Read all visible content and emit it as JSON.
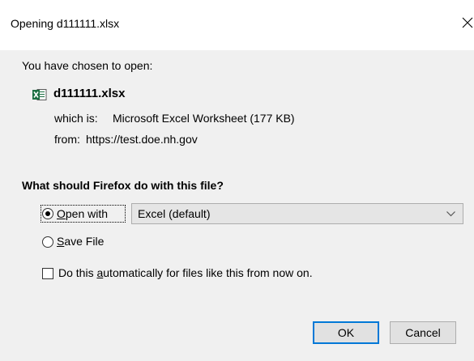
{
  "window": {
    "title": "Opening d111111.xlsx"
  },
  "intro": {
    "chosen_text": "You have chosen to open:"
  },
  "file": {
    "icon": "excel-file-icon",
    "name": "d111111.xlsx",
    "which_is_label": "which is:",
    "which_is_value": "Microsoft Excel Worksheet (177 KB)",
    "from_label": "from:",
    "from_value": "https://test.doe.nh.gov"
  },
  "action": {
    "question": "What should Firefox do with this file?",
    "open_with": {
      "prefix": "",
      "accel": "O",
      "rest": "pen with",
      "selected": true
    },
    "app_select": {
      "value": "Excel (default)"
    },
    "save_file": {
      "accel": "S",
      "rest": "ave File",
      "selected": false
    },
    "auto": {
      "before": "Do this ",
      "accel": "a",
      "after": "utomatically for files like this from now on.",
      "checked": false
    }
  },
  "buttons": {
    "ok": "OK",
    "cancel": "Cancel"
  },
  "colors": {
    "dialog_bg": "#f0f0f0",
    "title_bg": "#ffffff",
    "default_button_border": "#0078d7",
    "excel_green": "#1d6f42"
  }
}
